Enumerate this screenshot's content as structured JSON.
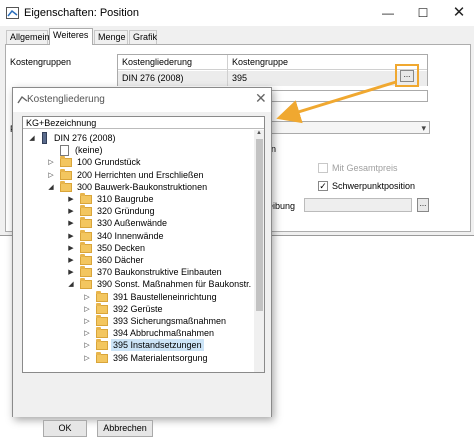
{
  "window": {
    "title": "Eigenschaften: Position",
    "minimize": "—",
    "maximize": "☐",
    "close": "✕"
  },
  "tabs": [
    "Allgemein",
    "Weiteres",
    "Menge",
    "Grafik"
  ],
  "kostengruppen": {
    "label": "Kostengruppen",
    "col1": "Kostengliederung",
    "col2": "Kostengruppe",
    "row_gliederung": "DIN 276 (2008)",
    "row_gruppe": "395",
    "browse": "..."
  },
  "behind": {
    "p_fragment": "P",
    "frag_en": "en",
    "mit_gesamtpreis": "Mit Gesamtpreis",
    "schwerpunktposition": "Schwerpunktposition",
    "schwerpunkt_checked": "✓",
    "beschr_fragment": "eibung",
    "beschr_btn": "..."
  },
  "dialog": {
    "title": "Kostengliederung",
    "close": "✕",
    "column_header": "KG+Bezeichnung",
    "ok": "OK",
    "cancel": "Abbrechen",
    "tree": [
      {
        "label": "DIN 276 (2008)",
        "exp": "◢"
      },
      {
        "label": "(keine)",
        "exp": ""
      },
      {
        "label": "100 Grundstück",
        "exp": "▷"
      },
      {
        "label": "200 Herrichten und Erschließen",
        "exp": "▷"
      },
      {
        "label": "300 Bauwerk-Baukonstruktionen",
        "exp": "◢"
      },
      {
        "label": "310 Baugrube",
        "exp": "▶"
      },
      {
        "label": "320 Gründung",
        "exp": "▶"
      },
      {
        "label": "330 Außenwände",
        "exp": "▶"
      },
      {
        "label": "340 Innenwände",
        "exp": "▶"
      },
      {
        "label": "350 Decken",
        "exp": "▶"
      },
      {
        "label": "360 Dächer",
        "exp": "▶"
      },
      {
        "label": "370 Baukonstruktive Einbauten",
        "exp": "▶"
      },
      {
        "label": "390 Sonst. Maßnahmen für Baukonstr.",
        "exp": "◢"
      },
      {
        "label": "391 Baustelleneinrichtung",
        "exp": "▷"
      },
      {
        "label": "392 Gerüste",
        "exp": "▷"
      },
      {
        "label": "393 Sicherungsmaßnahmen",
        "exp": "▷"
      },
      {
        "label": "394 Abbruchmaßnahmen",
        "exp": "▷"
      },
      {
        "label": "395 Instandsetzungen",
        "exp": "▷"
      },
      {
        "label": "396 Materialentsorgung",
        "exp": "▷"
      }
    ]
  },
  "colors": {
    "highlight": "#f0a830",
    "selection": "#cce4f7",
    "folder": "#f3c65f"
  }
}
